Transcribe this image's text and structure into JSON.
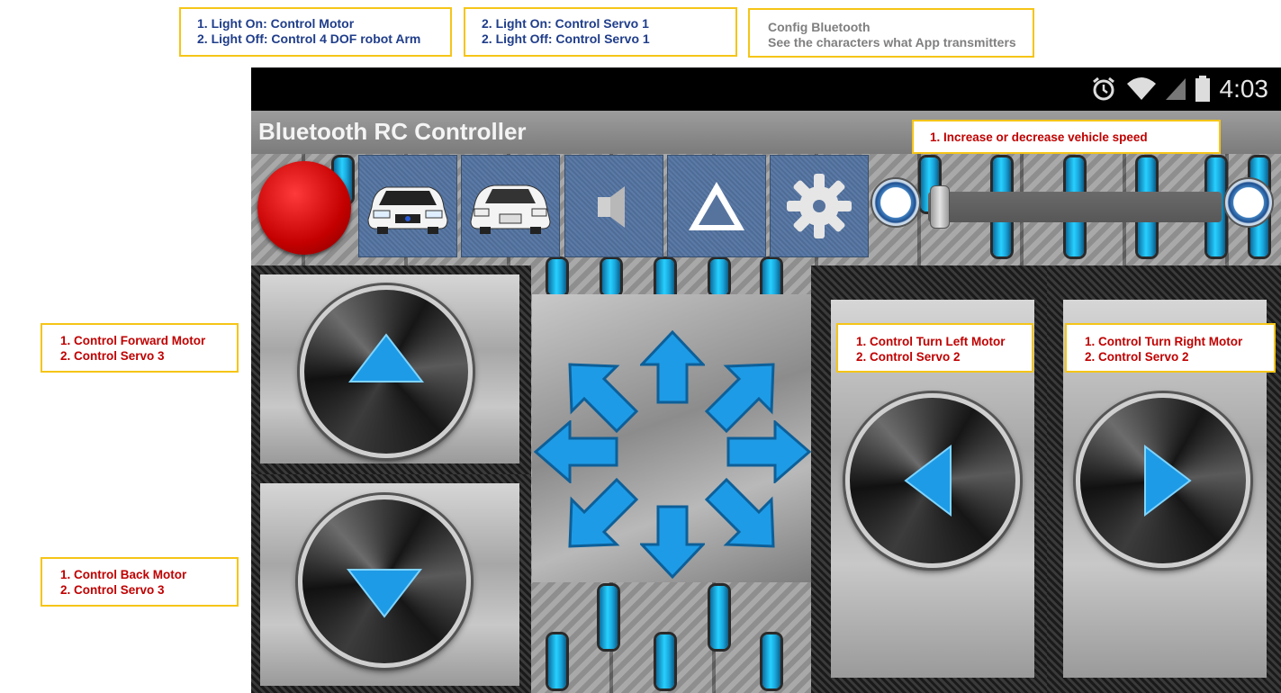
{
  "callouts": {
    "top1": {
      "line1": "1.  Light On: Control Motor",
      "line2": "2. Light Off: Control 4 DOF robot Arm"
    },
    "top2": {
      "line1": "2. Light On: Control Servo 1",
      "line2": "2. Light Off: Control Servo 1"
    },
    "top3": {
      "line1": "Config Bluetooth",
      "line2": "See the characters what App transmitters"
    },
    "speed": {
      "line1": "1. Increase or decrease vehicle speed"
    },
    "forward": {
      "line1": "1. Control Forward Motor",
      "line2": "2. Control Servo 3"
    },
    "back": {
      "line1": "1. Control Back Motor",
      "line2": "2. Control Servo 3"
    },
    "left": {
      "line1": "1. Control Turn Left Motor",
      "line2": "2. Control Servo 2"
    },
    "right": {
      "line1": "1. Control Turn Right Motor",
      "line2": "2. Control Servo 2"
    }
  },
  "status_bar": {
    "time": "4:03",
    "icons": [
      "alarm-icon",
      "wifi-icon",
      "signal-icon",
      "battery-icon"
    ]
  },
  "app": {
    "title": "Bluetooth RC Controller"
  },
  "toolbar": {
    "buttons": [
      "power-button",
      "front-light-button",
      "back-light-button",
      "horn-button",
      "hazard-button",
      "settings-button"
    ],
    "speed_slider": {
      "value_fraction": 0.0
    }
  },
  "colors": {
    "accent": "#ffc000",
    "callout_border": "#f5c518",
    "callout_blue": "#1f3d8a",
    "callout_red": "#c00000",
    "arrow_blue": "#1e9be6",
    "power_red": "#d40000",
    "tile_blue": "#56739e"
  }
}
